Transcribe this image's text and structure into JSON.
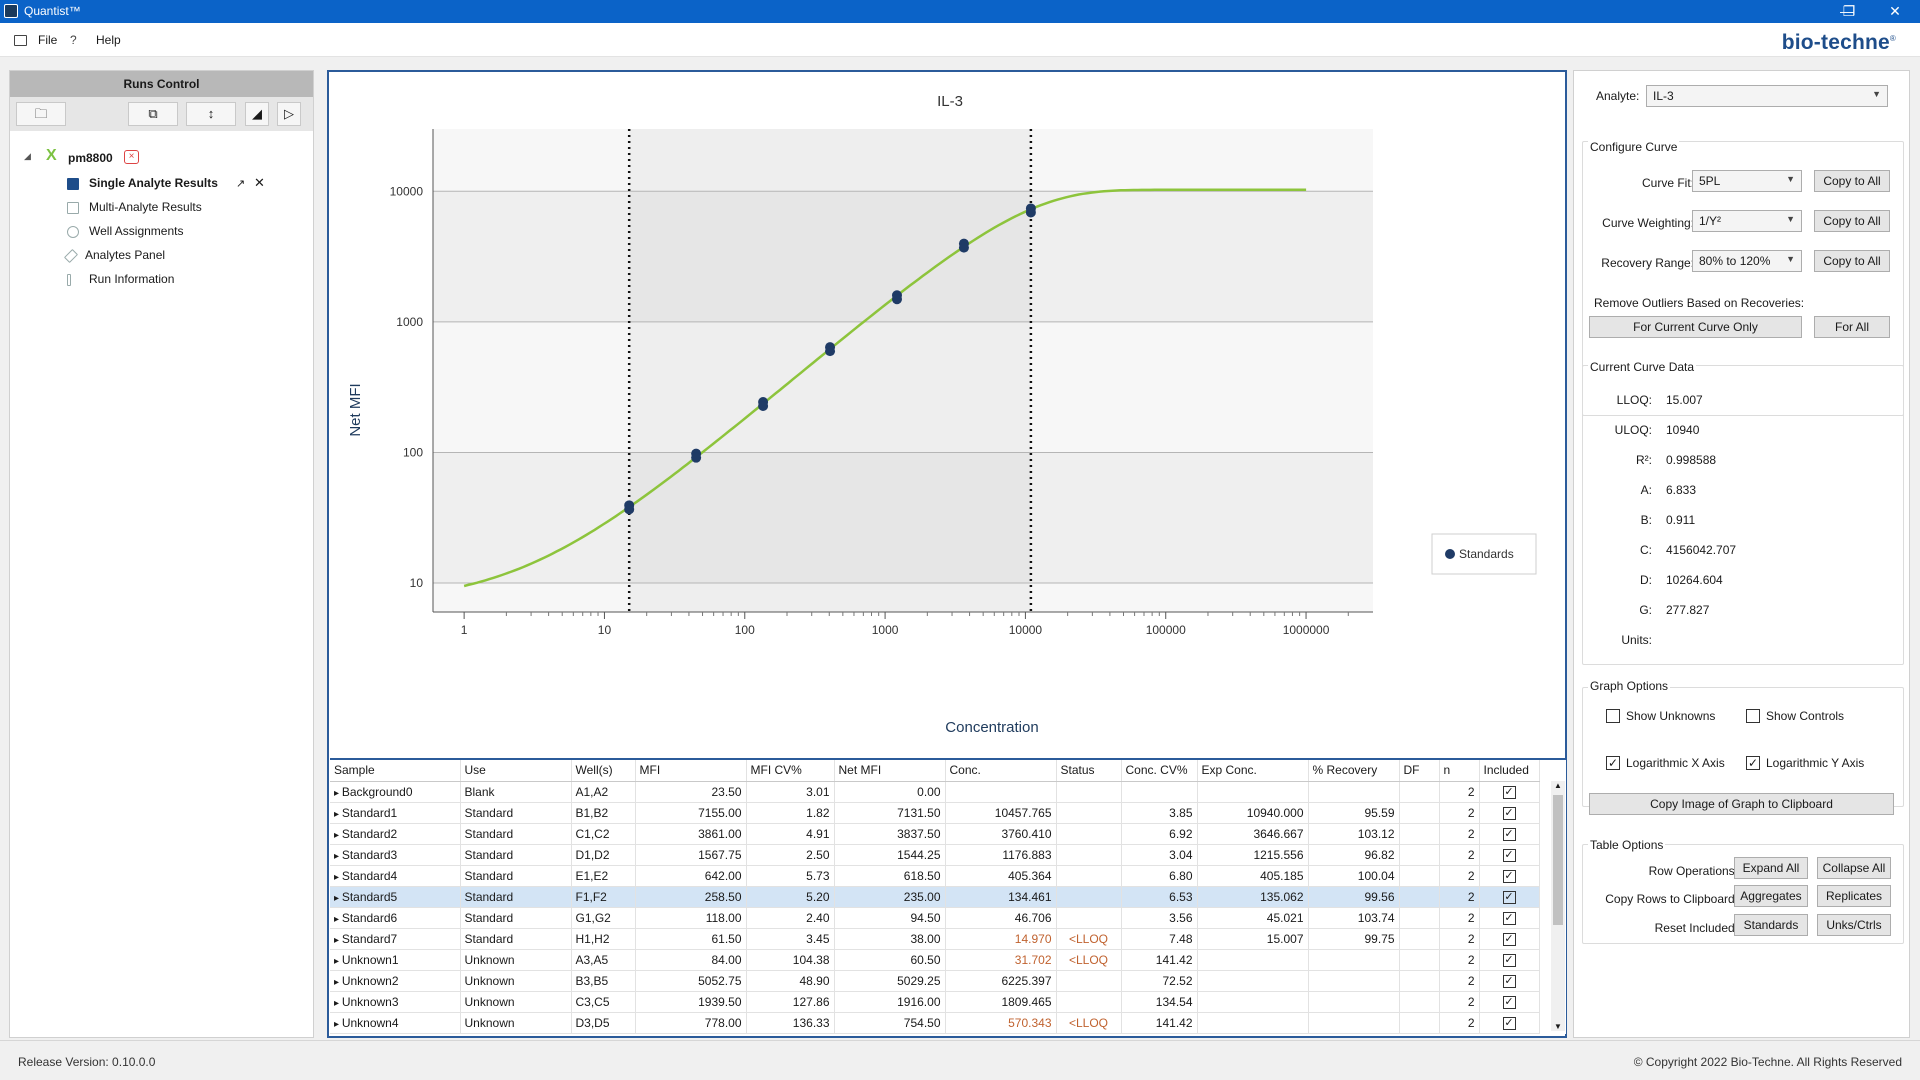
{
  "titlebar": {
    "title": "Quantist™",
    "minimize": "—",
    "restore": "❐",
    "close": "✕"
  },
  "menu": {
    "file": "File",
    "help": "Help",
    "brand": "bio-techne",
    "brand_mark": "®"
  },
  "runs_control": {
    "header": "Runs Control",
    "run_name": "pm8800",
    "items": [
      "Single Analyte Results",
      "Multi-Analyte Results",
      "Well Assignments",
      "Analytes Panel",
      "Run Information"
    ]
  },
  "chart_data": {
    "type": "scatter",
    "title": "IL-3",
    "xlabel": "Concentration",
    "ylabel": "Net MFI",
    "xscale": "log",
    "yscale": "log",
    "xlim": [
      0.6,
      3000000
    ],
    "ylim": [
      6,
      30000
    ],
    "x_ticks": [
      "1",
      "10",
      "100",
      "1000",
      "10000",
      "100000",
      "1000000"
    ],
    "y_ticks": [
      "10",
      "100",
      "1000",
      "10000"
    ],
    "legend": "Standards",
    "legend_position": "bottom-right",
    "lloq": 15.007,
    "uloq": 10940,
    "fit": {
      "A": 6.833,
      "B": 0.911,
      "C": 4156042.707,
      "D": 10264.604,
      "G": 277.827
    },
    "series": [
      {
        "name": "Standards",
        "x": [
          10940.0,
          3646.667,
          1215.556,
          405.185,
          135.062,
          45.021,
          15.007
        ],
        "y": [
          7131.5,
          3837.5,
          1544.25,
          618.5,
          235.0,
          94.5,
          38.0
        ]
      }
    ],
    "colors": {
      "curve": "#8dc43c",
      "points": "#1f3b66"
    }
  },
  "right": {
    "analyte_label": "Analyte:",
    "analyte_value": "IL-3",
    "configure_title": "Configure Curve",
    "curve_fit_label": "Curve Fit:",
    "curve_fit_value": "5PL",
    "curve_weighting_label": "Curve Weighting:",
    "curve_weighting_value": "1/Y²",
    "recovery_range_label": "Recovery Range:",
    "recovery_range_value": "80% to 120%",
    "copy_to_all": "Copy to All",
    "remove_outliers_label": "Remove Outliers Based on Recoveries:",
    "for_current": "For Current Curve Only",
    "for_all": "For All",
    "current_curve_title": "Current Curve Data",
    "curve_data": [
      {
        "label": "LLOQ:",
        "value": "15.007"
      },
      {
        "label": "ULOQ:",
        "value": "10940"
      },
      {
        "label": "R²:",
        "value": "0.998588"
      },
      {
        "label": "A:",
        "value": "6.833"
      },
      {
        "label": "B:",
        "value": "0.911"
      },
      {
        "label": "C:",
        "value": "4156042.707"
      },
      {
        "label": "D:",
        "value": "10264.604"
      },
      {
        "label": "G:",
        "value": "277.827"
      },
      {
        "label": "Units:",
        "value": ""
      }
    ],
    "graph_options_title": "Graph Options",
    "show_unknowns": "Show Unknowns",
    "show_controls": "Show Controls",
    "log_x": "Logarithmic X Axis",
    "log_y": "Logarithmic Y Axis",
    "copy_image": "Copy Image of Graph to Clipboard",
    "table_options_title": "Table Options",
    "row_ops_label": "Row Operations:",
    "expand_all": "Expand All",
    "collapse_all": "Collapse All",
    "copy_rows_label": "Copy Rows to Clipboard:",
    "aggregates": "Aggregates",
    "replicates": "Replicates",
    "reset_included_label": "Reset Included:",
    "standards": "Standards",
    "unks_ctrls": "Unks/Ctrls"
  },
  "table": {
    "columns": [
      "Sample",
      "Use",
      "Well(s)",
      "MFI",
      "MFI CV%",
      "Net MFI",
      "Conc.",
      "Status",
      "Conc. CV%",
      "Exp Conc.",
      "% Recovery",
      "DF",
      "n",
      "Included"
    ],
    "rows": [
      [
        "Background0",
        "Blank",
        "A1,A2",
        "23.50",
        "3.01",
        "0.00",
        "",
        "",
        "",
        "",
        "",
        "",
        "2"
      ],
      [
        "Standard1",
        "Standard",
        "B1,B2",
        "7155.00",
        "1.82",
        "7131.50",
        "10457.765",
        "",
        "3.85",
        "10940.000",
        "95.59",
        "",
        "2"
      ],
      [
        "Standard2",
        "Standard",
        "C1,C2",
        "3861.00",
        "4.91",
        "3837.50",
        "3760.410",
        "",
        "6.92",
        "3646.667",
        "103.12",
        "",
        "2"
      ],
      [
        "Standard3",
        "Standard",
        "D1,D2",
        "1567.75",
        "2.50",
        "1544.25",
        "1176.883",
        "",
        "3.04",
        "1215.556",
        "96.82",
        "",
        "2"
      ],
      [
        "Standard4",
        "Standard",
        "E1,E2",
        "642.00",
        "5.73",
        "618.50",
        "405.364",
        "",
        "6.80",
        "405.185",
        "100.04",
        "",
        "2"
      ],
      [
        "Standard5",
        "Standard",
        "F1,F2",
        "258.50",
        "5.20",
        "235.00",
        "134.461",
        "",
        "6.53",
        "135.062",
        "99.56",
        "",
        "2"
      ],
      [
        "Standard6",
        "Standard",
        "G1,G2",
        "118.00",
        "2.40",
        "94.50",
        "46.706",
        "",
        "3.56",
        "45.021",
        "103.74",
        "",
        "2"
      ],
      [
        "Standard7",
        "Standard",
        "H1,H2",
        "61.50",
        "3.45",
        "38.00",
        "14.970",
        "<LLOQ",
        "7.48",
        "15.007",
        "99.75",
        "",
        "2"
      ],
      [
        "Unknown1",
        "Unknown",
        "A3,A5",
        "84.00",
        "104.38",
        "60.50",
        "31.702",
        "<LLOQ",
        "141.42",
        "",
        "",
        "",
        "2"
      ],
      [
        "Unknown2",
        "Unknown",
        "B3,B5",
        "5052.75",
        "48.90",
        "5029.25",
        "6225.397",
        "",
        "72.52",
        "",
        "",
        "",
        "2"
      ],
      [
        "Unknown3",
        "Unknown",
        "C3,C5",
        "1939.50",
        "127.86",
        "1916.00",
        "1809.465",
        "",
        "134.54",
        "",
        "",
        "",
        "2"
      ],
      [
        "Unknown4",
        "Unknown",
        "D3,D5",
        "778.00",
        "136.33",
        "754.50",
        "570.343",
        "<LLOQ",
        "141.42",
        "",
        "",
        "",
        "2"
      ]
    ],
    "selected_row": 5
  },
  "status": {
    "release": "Release Version: 0.10.0.0",
    "copyright": "© Copyright 2022 Bio-Techne. All Rights Reserved"
  }
}
